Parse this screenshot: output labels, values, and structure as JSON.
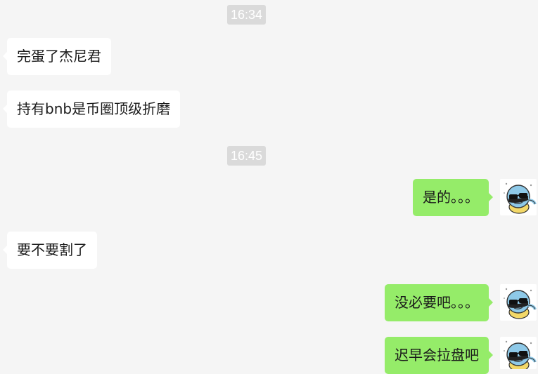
{
  "chat": {
    "timestamps": [
      "16:34",
      "16:45"
    ],
    "messages": [
      {
        "side": "in",
        "text": "完蛋了杰尼君"
      },
      {
        "side": "in",
        "text": "持有bnb是币圈顶级折磨"
      },
      {
        "side": "out",
        "text": "是的。。。"
      },
      {
        "side": "in",
        "text": "要不要割了"
      },
      {
        "side": "out",
        "text": "没必要吧。。。"
      },
      {
        "side": "out",
        "text": "迟早会拉盘吧"
      }
    ],
    "avatar_icon": "squirtle-sunglasses-icon"
  },
  "colors": {
    "background": "#f5f5f5",
    "incoming_bubble": "#ffffff",
    "outgoing_bubble": "#95ec69",
    "timestamp_bg": "#dadada",
    "timestamp_text": "#ffffff"
  }
}
